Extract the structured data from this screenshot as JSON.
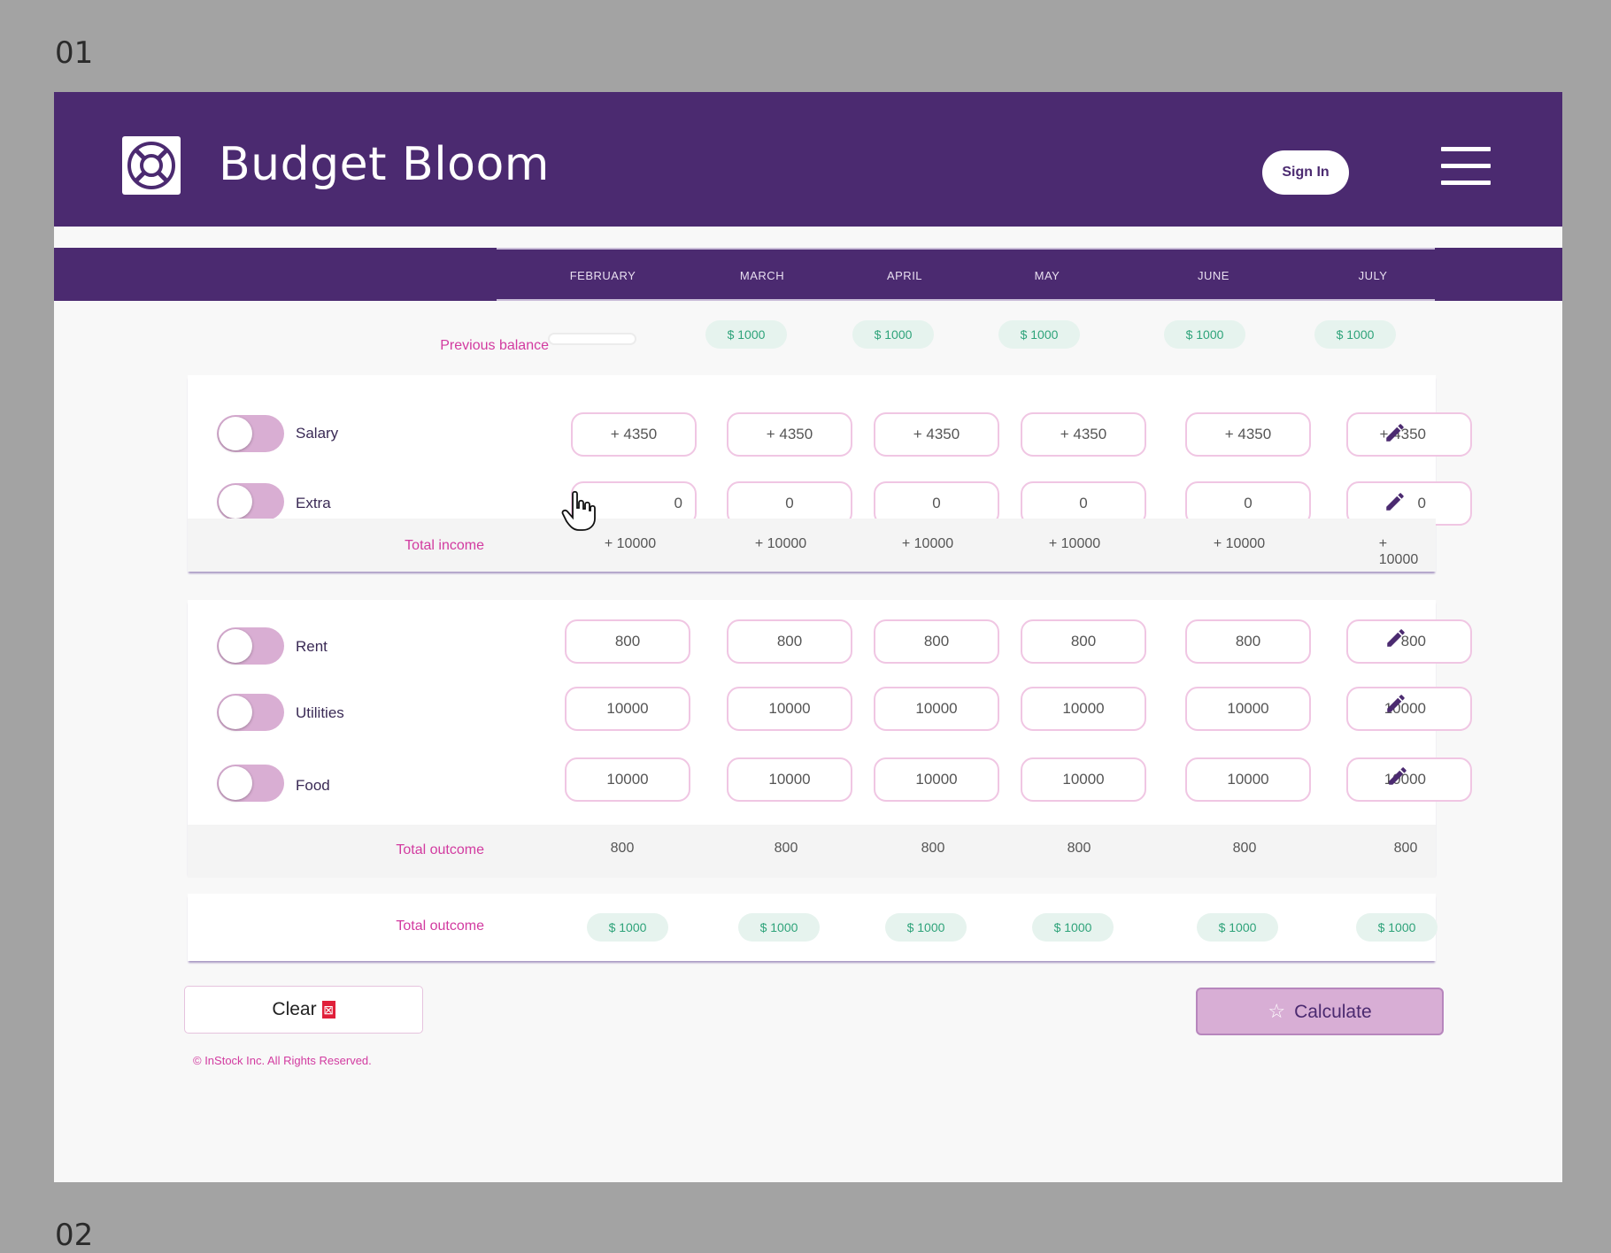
{
  "frame": {
    "label": "01",
    "next_label": "02"
  },
  "header": {
    "title": "Budget Bloom",
    "sign_in": "Sign In"
  },
  "months": [
    "FEBRUARY",
    "MARCH",
    "APRIL",
    "MAY",
    "JUNE",
    "JULY"
  ],
  "previous_balance": {
    "label": "Previous balance",
    "values": [
      "",
      "$ 1000",
      "$ 1000",
      "$ 1000",
      "$ 1000",
      "$ 1000"
    ]
  },
  "income": {
    "rows": [
      {
        "label": "Salary",
        "values": [
          "+ 4350",
          "+ 4350",
          "+ 4350",
          "+ 4350",
          "+ 4350",
          "+ 4350"
        ]
      },
      {
        "label": "Extra",
        "values": [
          "0",
          "0",
          "0",
          "0",
          "0",
          "0"
        ]
      }
    ],
    "total_label": "Total income",
    "totals": [
      "+ 10000",
      "+ 10000",
      "+ 10000",
      "+ 10000",
      "+ 10000",
      "+ 10000"
    ]
  },
  "outcome": {
    "rows": [
      {
        "label": "Rent",
        "values": [
          "800",
          "800",
          "800",
          "800",
          "800",
          "800"
        ]
      },
      {
        "label": "Utilities",
        "values": [
          "10000",
          "10000",
          "10000",
          "10000",
          "10000",
          "10000"
        ]
      },
      {
        "label": "Food",
        "values": [
          "10000",
          "10000",
          "10000",
          "10000",
          "10000",
          "10000"
        ]
      }
    ],
    "total_label": "Total  outcome",
    "totals": [
      "800",
      "800",
      "800",
      "800",
      "800",
      "800"
    ]
  },
  "summary": {
    "label": "Total  outcome",
    "values": [
      "$ 1000",
      "$ 1000",
      "$ 1000",
      "$ 1000",
      "$ 1000",
      "$ 1000"
    ]
  },
  "actions": {
    "clear": "Clear",
    "clear_icon": "⊠",
    "calculate": "Calculate",
    "calculate_icon": "☆"
  },
  "footer": {
    "copyright": "© InStock Inc. All Rights Reserved."
  },
  "colors": {
    "primary": "#4b2a70",
    "accent_pink": "#d23ba0",
    "toggle": "#d9aed3",
    "money_green": "#2ea37a",
    "money_bg": "#e6f3ee",
    "input_border": "#f0c6e3",
    "calculate_bg": "#d8aed5"
  }
}
